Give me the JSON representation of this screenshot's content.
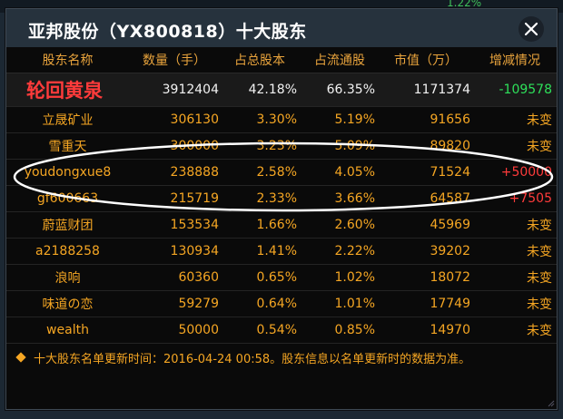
{
  "background": {
    "peek_text": "1.22%"
  },
  "dialog": {
    "title": "亚邦股份（YX800818）十大股东",
    "close_icon": "close-icon"
  },
  "table": {
    "headers": [
      "股东名称",
      "数量（手）",
      "占总股本",
      "占流通股",
      "市值（万）",
      "增减情况"
    ],
    "rows": [
      {
        "name": "轮回黄泉",
        "qty": "3912404",
        "total_pct": "42.18%",
        "float_pct": "66.35%",
        "mkt": "1171374",
        "change": "-109578",
        "change_type": "neg"
      },
      {
        "name": "立晟矿业",
        "qty": "306130",
        "total_pct": "3.30%",
        "float_pct": "5.19%",
        "mkt": "91656",
        "change": "未变",
        "change_type": "flat"
      },
      {
        "name": "雪重天",
        "qty": "300000",
        "total_pct": "3.23%",
        "float_pct": "5.09%",
        "mkt": "89820",
        "change": "未变",
        "change_type": "flat"
      },
      {
        "name": "youdongxue8",
        "qty": "238888",
        "total_pct": "2.58%",
        "float_pct": "4.05%",
        "mkt": "71524",
        "change": "+50000",
        "change_type": "pos"
      },
      {
        "name": "gf600663",
        "qty": "215719",
        "total_pct": "2.33%",
        "float_pct": "3.66%",
        "mkt": "64587",
        "change": "+7505",
        "change_type": "pos"
      },
      {
        "name": "蔚蓝财团",
        "qty": "153534",
        "total_pct": "1.66%",
        "float_pct": "2.60%",
        "mkt": "45969",
        "change": "未变",
        "change_type": "flat"
      },
      {
        "name": "a2188258",
        "qty": "130934",
        "total_pct": "1.41%",
        "float_pct": "2.22%",
        "mkt": "39202",
        "change": "未变",
        "change_type": "flat"
      },
      {
        "name": "浪响",
        "qty": "60360",
        "total_pct": "0.65%",
        "float_pct": "1.02%",
        "mkt": "18072",
        "change": "未变",
        "change_type": "flat"
      },
      {
        "name": "味道の恋",
        "qty": "59279",
        "total_pct": "0.64%",
        "float_pct": "1.01%",
        "mkt": "17749",
        "change": "未变",
        "change_type": "flat"
      },
      {
        "name": "wealth",
        "qty": "50000",
        "total_pct": "0.54%",
        "float_pct": "0.85%",
        "mkt": "14970",
        "change": "未变",
        "change_type": "flat"
      }
    ]
  },
  "footer": {
    "note": "十大股东名单更新时间：2016-04-24 00:58。股东信息以名单更新时的数据为准。"
  },
  "colors": {
    "title_bg": "#26323d",
    "body_bg": "#0a0a0a",
    "text_orange": "#f5a623",
    "top_holder_red": "#ff3b3b",
    "decrease_green": "#2ee05a"
  }
}
